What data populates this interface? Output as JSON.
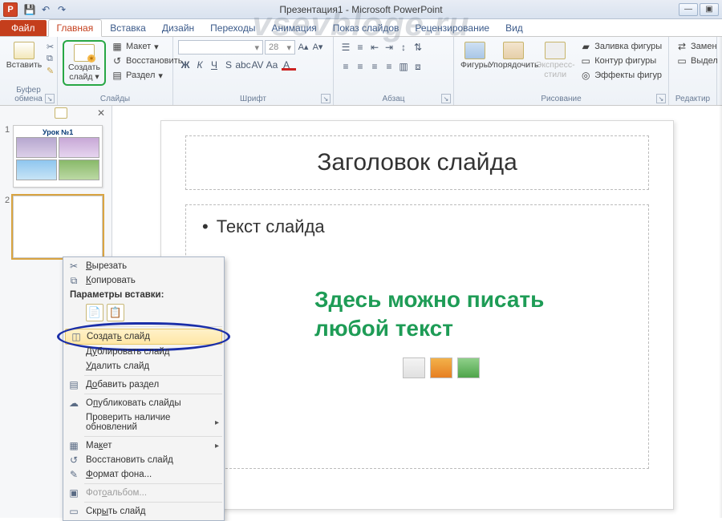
{
  "title": "Презентация1 - Microsoft PowerPoint",
  "watermark": "vsevbloge.ru",
  "qat": {
    "save": "💾",
    "undo": "↶",
    "redo": "↷"
  },
  "win": {
    "min": "—",
    "max": "▢",
    "close": "✕",
    "help": "?",
    "restore": "▣"
  },
  "tabs": {
    "file": "Файл",
    "home": "Главная",
    "insert": "Вставка",
    "design": "Дизайн",
    "transitions": "Переходы",
    "animations": "Анимация",
    "slideshow": "Показ слайдов",
    "review": "Рецензирование",
    "view": "Вид"
  },
  "ribbon": {
    "clipboard": {
      "paste": "Вставить",
      "label": "Буфер обмена"
    },
    "slides": {
      "newslide": "Создать слайд",
      "layout": "Макет",
      "reset": "Восстановить",
      "section": "Раздел",
      "label": "Слайды"
    },
    "font": {
      "size": "28",
      "label": "Шрифт"
    },
    "paragraph": {
      "label": "Абзац"
    },
    "drawing": {
      "shapes": "Фигуры",
      "arrange": "Упорядочить",
      "quick": "Экспресс-стили",
      "fill": "Заливка фигуры",
      "outline": "Контур фигуры",
      "effects": "Эффекты фигур",
      "label": "Рисование"
    },
    "editing": {
      "replace": "Замен",
      "select": "Выдел",
      "label": "Редактир"
    }
  },
  "thumbs": {
    "n1": "1",
    "t1": "Урок №1",
    "n2": "2"
  },
  "slide": {
    "title": "Заголовок слайда",
    "bullet": "Текст слайда",
    "overlay1": "Здесь можно писать",
    "overlay2": "любой текст"
  },
  "ctx": {
    "cut": "Вырезать",
    "copy": "Копировать",
    "paste_hdr": "Параметры вставки:",
    "new": "Создать слайд",
    "dup": "Дублировать слайд",
    "del": "Удалить слайд",
    "section": "Добавить раздел",
    "publish": "Опубликовать слайды",
    "updates": "Проверить наличие обновлений",
    "layout": "Макет",
    "reset": "Восстановить слайд",
    "format": "Формат фона...",
    "album": "Фотоальбом...",
    "hide": "Скрыть слайд"
  }
}
